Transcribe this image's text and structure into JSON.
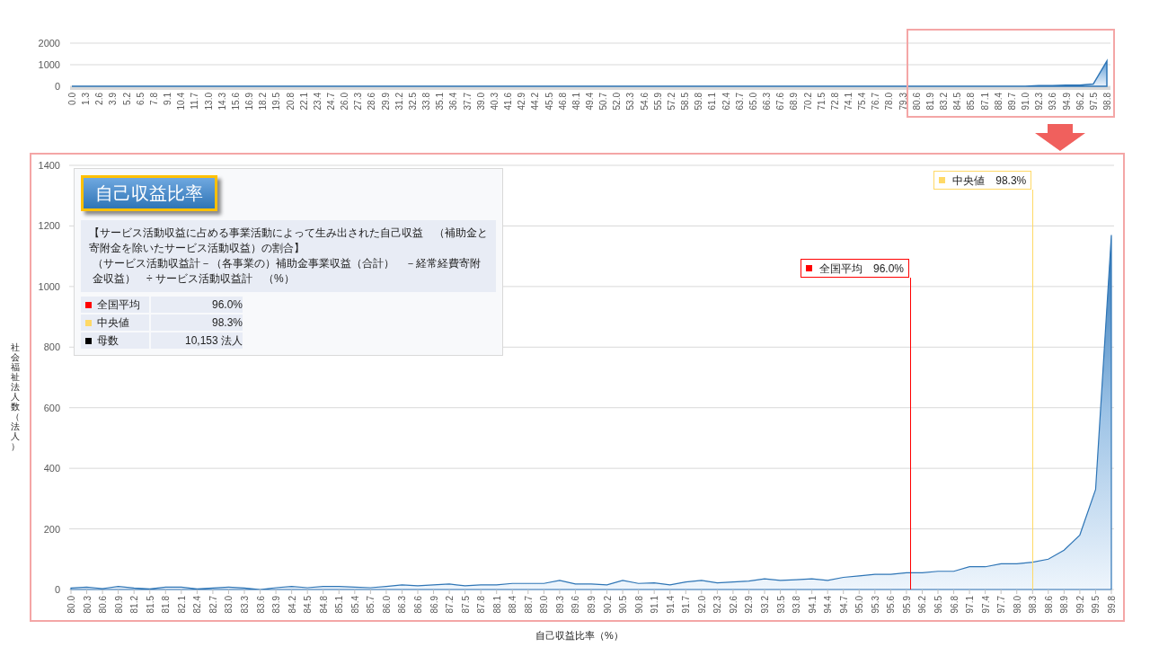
{
  "overview_chart": {
    "chart_data": {
      "type": "area",
      "categories": [
        "0.0",
        "1.3",
        "2.6",
        "3.9",
        "5.2",
        "6.5",
        "7.8",
        "9.1",
        "10.4",
        "11.7",
        "13.0",
        "14.3",
        "15.6",
        "16.9",
        "18.2",
        "19.5",
        "20.8",
        "22.1",
        "23.4",
        "24.7",
        "26.0",
        "27.3",
        "28.6",
        "29.9",
        "31.2",
        "32.5",
        "33.8",
        "35.1",
        "36.4",
        "37.7",
        "39.0",
        "40.3",
        "41.6",
        "42.9",
        "44.2",
        "45.5",
        "46.8",
        "48.1",
        "49.4",
        "50.7",
        "52.0",
        "53.3",
        "54.6",
        "55.9",
        "57.2",
        "58.5",
        "59.8",
        "61.1",
        "62.4",
        "63.7",
        "65.0",
        "66.3",
        "67.6",
        "68.9",
        "70.2",
        "71.5",
        "72.8",
        "74.1",
        "75.4",
        "76.7",
        "78.0",
        "79.3",
        "80.6",
        "81.9",
        "83.2",
        "84.5",
        "85.8",
        "87.1",
        "88.4",
        "89.7",
        "91.0",
        "92.3",
        "93.6",
        "94.9",
        "96.2",
        "97.5",
        "98.8"
      ],
      "series": [
        {
          "color": "#2e75b6",
          "values": [
            0,
            0,
            0,
            0,
            0,
            0,
            0,
            0,
            0,
            0,
            0,
            0,
            0,
            0,
            0,
            0,
            0,
            0,
            0,
            0,
            0,
            0,
            0,
            0,
            0,
            0,
            0,
            0,
            0,
            0,
            0,
            0,
            0,
            0,
            0,
            0,
            0,
            0,
            0,
            0,
            0,
            0,
            0,
            0,
            0,
            0,
            0,
            0,
            0,
            0,
            0,
            0,
            0,
            0,
            0,
            0,
            0,
            0,
            0,
            0,
            0,
            0,
            0,
            0,
            0,
            0,
            0,
            0,
            0,
            0,
            0,
            30,
            30,
            50,
            50,
            100,
            1170
          ]
        }
      ],
      "yticks": [
        0,
        1000,
        2000
      ],
      "ylim": [
        0,
        2000
      ],
      "grid": true
    }
  },
  "zoom_chart": {
    "ylabel": "社会福祉法人数（法人）",
    "chart_data": {
      "type": "area",
      "xlabel": "自己収益比率（%）",
      "categories": [
        "80.0",
        "80.3",
        "80.6",
        "80.9",
        "81.2",
        "81.5",
        "81.8",
        "82.1",
        "82.4",
        "82.7",
        "83.0",
        "83.3",
        "83.6",
        "83.9",
        "84.2",
        "84.5",
        "84.8",
        "85.1",
        "85.4",
        "85.7",
        "86.0",
        "86.3",
        "86.6",
        "86.9",
        "87.2",
        "87.5",
        "87.8",
        "88.1",
        "88.4",
        "88.7",
        "89.0",
        "89.3",
        "89.6",
        "89.9",
        "90.2",
        "90.5",
        "90.8",
        "91.1",
        "91.4",
        "91.7",
        "92.0",
        "92.3",
        "92.6",
        "92.9",
        "93.2",
        "93.5",
        "93.8",
        "94.1",
        "94.4",
        "94.7",
        "95.0",
        "95.3",
        "95.6",
        "95.9",
        "96.2",
        "96.5",
        "96.8",
        "97.1",
        "97.4",
        "97.7",
        "98.0",
        "98.3",
        "98.6",
        "98.9",
        "99.2",
        "99.5",
        "99.8"
      ],
      "series": [
        {
          "color": "#2e75b6",
          "values": [
            5,
            8,
            3,
            10,
            5,
            2,
            8,
            8,
            2,
            5,
            8,
            5,
            0,
            6,
            10,
            6,
            10,
            10,
            8,
            6,
            10,
            15,
            12,
            15,
            18,
            12,
            15,
            15,
            20,
            20,
            20,
            30,
            18,
            18,
            15,
            30,
            20,
            22,
            15,
            25,
            30,
            22,
            25,
            28,
            35,
            30,
            32,
            35,
            30,
            40,
            45,
            50,
            50,
            55,
            55,
            60,
            60,
            75,
            75,
            85,
            85,
            90,
            100,
            130,
            180,
            330,
            1170
          ]
        }
      ],
      "yticks": [
        0,
        200,
        400,
        600,
        800,
        1000,
        1200,
        1400
      ],
      "ylim": [
        0,
        1400
      ],
      "grid": true
    },
    "markers": [
      {
        "label": "全国平均　96.0%",
        "color": "#ff0000"
      },
      {
        "label": "中央値　98.3%",
        "color": "#ffd966"
      }
    ]
  },
  "legend": {
    "title": "自己収益比率",
    "description": [
      "【サービス活動収益に占める事業活動によって生み出された自己収益　（補助金と寄附金を除いたサービス活動収益）の割合】",
      "（サービス活動収益計－（各事業の）補助金事業収益（合計）　－経常経費寄附金収益）　÷ サービス活動収益計　（%）"
    ],
    "rows": [
      {
        "label": "全国平均",
        "value": "96.0%",
        "color": "#ff0000"
      },
      {
        "label": "中央値",
        "value": "98.3%",
        "color": "#ffd966"
      },
      {
        "label": "母数",
        "value": "10,153 法人",
        "color": "#000000"
      }
    ]
  }
}
